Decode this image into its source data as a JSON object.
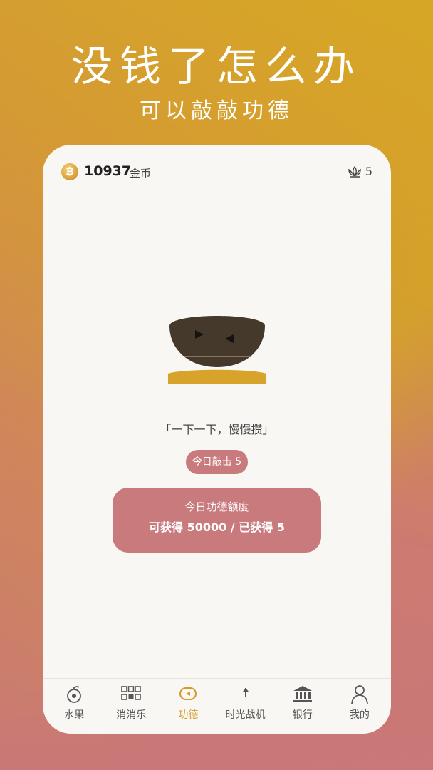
{
  "promo": {
    "headline": "没钱了怎么办",
    "subline": "可以敲敲功德"
  },
  "header": {
    "coin_amount": "10937",
    "coin_unit": "金币",
    "coin_symbol": "₿",
    "merit_count": "5"
  },
  "main": {
    "quote": "「一下一下，慢慢攒」",
    "today_taps": "今日敲击 5",
    "quota_title": "今日功德额度",
    "quota_value": "可获得 50000 / 已获得 5"
  },
  "tabs": [
    {
      "label": "水果",
      "icon": "fruit-icon",
      "active": false
    },
    {
      "label": "消消乐",
      "icon": "grid-icon",
      "active": false
    },
    {
      "label": "功德",
      "icon": "wooden-fish-icon",
      "active": true
    },
    {
      "label": "时光战机",
      "icon": "plane-icon",
      "active": false
    },
    {
      "label": "银行",
      "icon": "bank-icon",
      "active": false
    },
    {
      "label": "我的",
      "icon": "person-icon",
      "active": false
    }
  ],
  "colors": {
    "accent": "#d59a28",
    "card": "#c97a7c",
    "panel": "#f8f7f3"
  }
}
